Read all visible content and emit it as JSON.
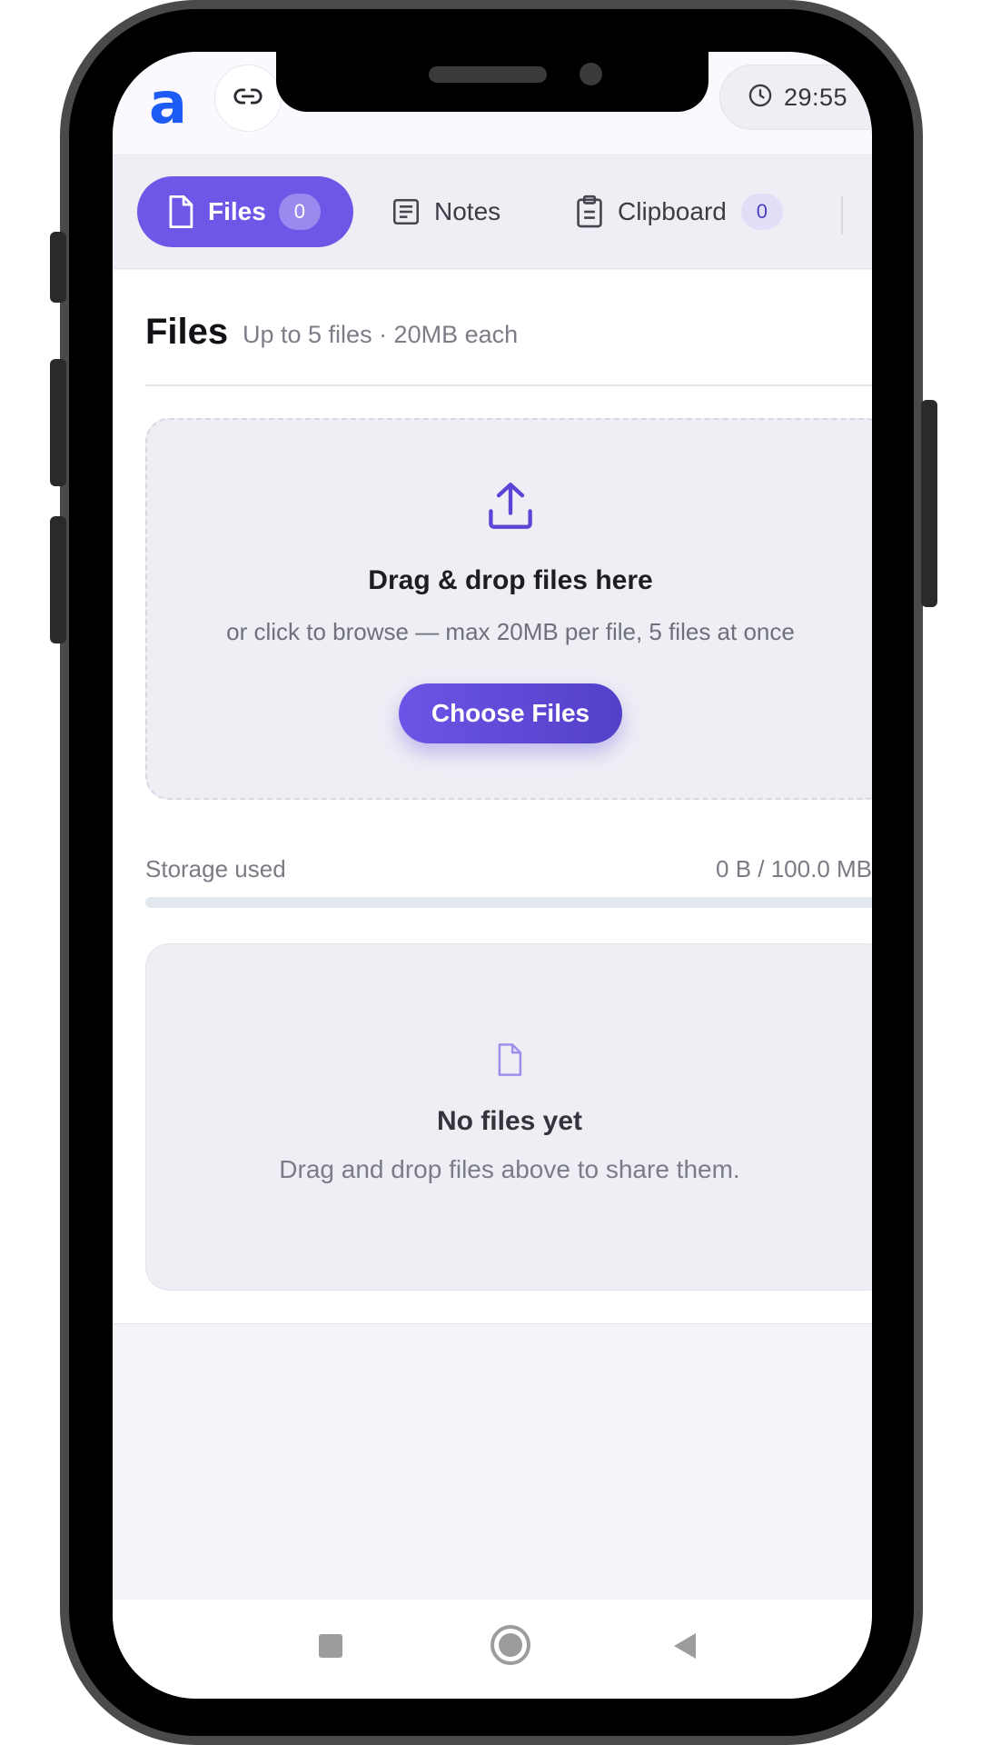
{
  "header": {
    "logo_text": "a",
    "timer": "29:55",
    "colors": {
      "logo": "#1c5cf5"
    }
  },
  "tabs": [
    {
      "label": "Files",
      "count": "0",
      "icon": "file-icon",
      "active": true
    },
    {
      "label": "Notes",
      "icon": "notes-icon",
      "active": false
    },
    {
      "label": "Clipboard",
      "count": "0",
      "icon": "clipboard-icon",
      "active": false
    }
  ],
  "files_section": {
    "title": "Files",
    "subtitle": "Up to 5 files · 20MB each"
  },
  "dropzone": {
    "icon": "upload-icon",
    "title": "Drag & drop files here",
    "subtitle": "or click to browse — max 20MB per file, 5 files at once",
    "button_label": "Choose Files"
  },
  "storage": {
    "label": "Storage used",
    "value": "0 B / 100.0 MB",
    "fraction_used": 0
  },
  "empty_state": {
    "icon": "file-icon",
    "title": "No files yet",
    "subtitle": "Drag and drop files above to share them."
  },
  "theme": {
    "accent": "#6d57e6",
    "background": "#f3f4f8"
  }
}
